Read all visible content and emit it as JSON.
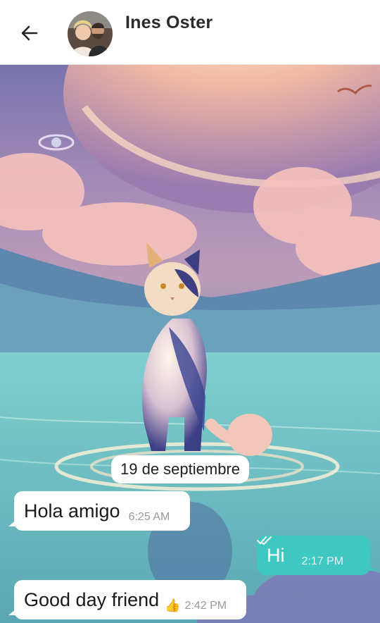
{
  "header": {
    "contact_name": "Ines Oster",
    "back_icon": "arrow-left-icon",
    "avatar_icon": "contact-avatar"
  },
  "chat": {
    "wallpaper": "cat-on-water-planet-wallpaper",
    "date_divider": "19 de septiembre",
    "messages": [
      {
        "direction": "incoming",
        "text": "Hola amigo",
        "time": "6:25 AM"
      },
      {
        "direction": "outgoing",
        "text": "Hi",
        "time": "2:17 PM",
        "status_icon": "double-check-icon"
      },
      {
        "direction": "incoming",
        "text": "Good day friend",
        "emoji": "👍",
        "time": "2:42 PM"
      }
    ]
  },
  "colors": {
    "outgoing_bubble": "#3fc8c1",
    "incoming_bubble": "#ffffff",
    "header_bg": "#ffffff"
  }
}
